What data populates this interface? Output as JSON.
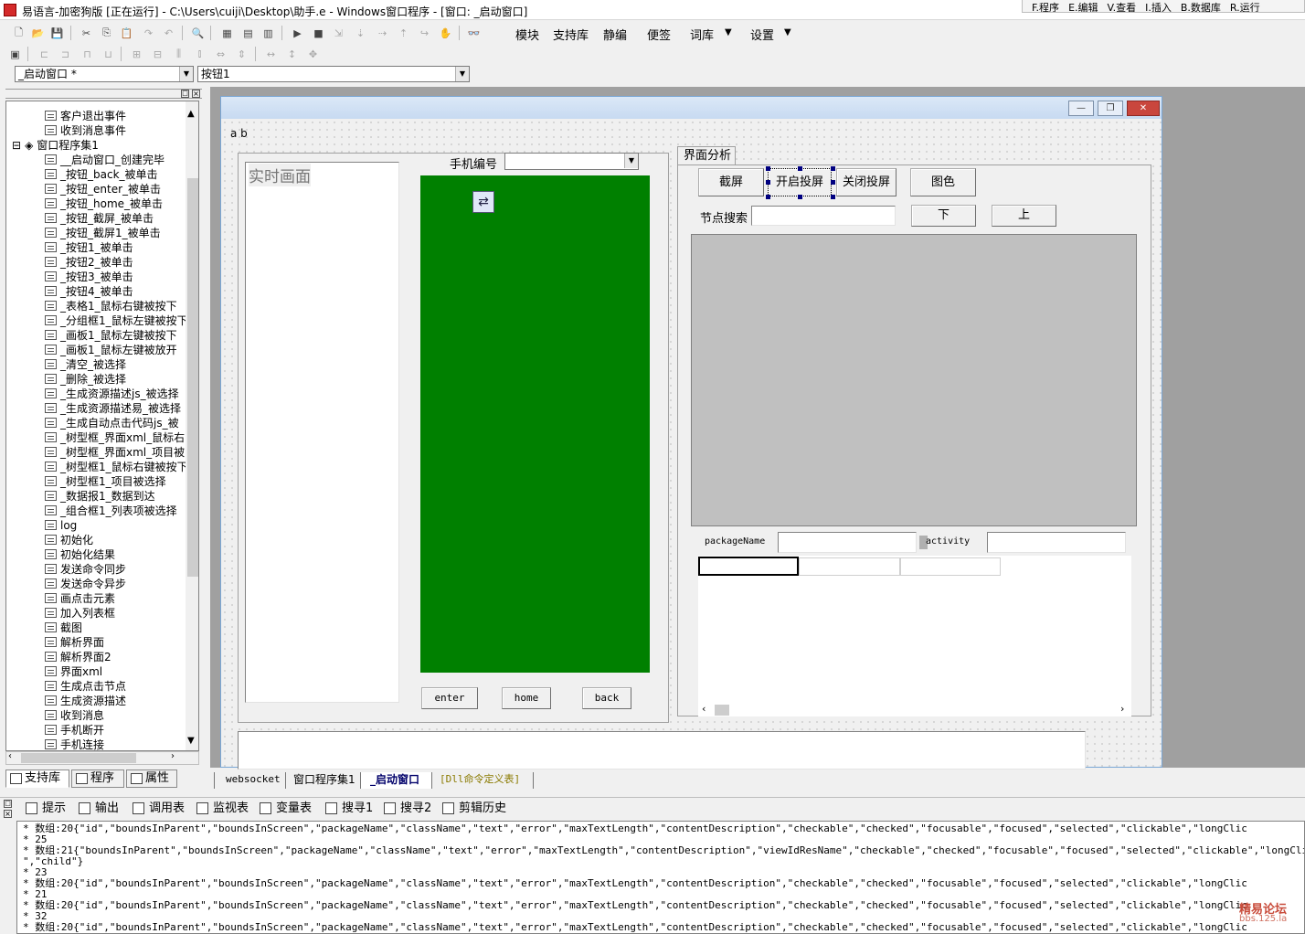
{
  "window": {
    "title": "易语言-加密狗版 [正在运行] - C:\\Users\\cuiji\\Desktop\\助手.e - Windows窗口程序 - [窗口: _启动窗口]"
  },
  "float_menu": [
    "F.程序",
    "E.编辑",
    "V.查看",
    "I.插入",
    "B.数据库",
    "R.运行"
  ],
  "main_menu": [
    "模块",
    "支持库",
    "静编",
    "便签",
    "词库",
    "设置"
  ],
  "combos": {
    "object": "_启动窗口 *",
    "component": "按钮1"
  },
  "tree": [
    "客户退出事件",
    "收到消息事件",
    "窗口程序集1",
    "__启动窗口_创建完毕",
    "_按钮_back_被单击",
    "_按钮_enter_被单击",
    "_按钮_home_被单击",
    "_按钮_截屏_被单击",
    "_按钮_截屏1_被单击",
    "_按钮1_被单击",
    "_按钮2_被单击",
    "_按钮3_被单击",
    "_按钮4_被单击",
    "_表格1_鼠标右键被按下",
    "_分组框1_鼠标左键被按下",
    "_画板1_鼠标左键被按下",
    "_画板1_鼠标左键被放开",
    "_清空_被选择",
    "_删除_被选择",
    "_生成资源描述js_被选择",
    "_生成资源描述易_被选择",
    "_生成自动点击代码js_被",
    "_树型框_界面xml_鼠标右",
    "_树型框_界面xml_项目被",
    "_树型框1_鼠标右键被按下",
    "_树型框1_项目被选择",
    "_数据报1_数据到达",
    "_组合框1_列表项被选择",
    "log",
    "初始化",
    "初始化结果",
    "发送命令同步",
    "发送命令异步",
    "画点击元素",
    "加入列表框",
    "截图",
    "解析界面",
    "解析界面2",
    "界面xml",
    "生成点击节点",
    "生成资源描述",
    "收到消息",
    "手机断开",
    "手机连接"
  ],
  "left_tabs": [
    "支持库",
    "程序",
    "属性"
  ],
  "form": {
    "top_label": "a  b",
    "realtime_label": "实时画面",
    "phone_label": "手机编号",
    "phone_value": "",
    "nav_buttons": [
      "enter",
      "home",
      "back"
    ],
    "panel_tab": "界面分析",
    "buttons": [
      "截屏",
      "开启投屏",
      "关闭投屏",
      "图色"
    ],
    "node_search_label": "节点搜索",
    "node_search_value": "",
    "down_label": "下",
    "up_label": "上",
    "package_label": "packageName",
    "package_value": "",
    "activity_label": "activity",
    "activity_value": ""
  },
  "doc_tabs": [
    "websocket",
    "窗口程序集1",
    "_启动窗口",
    "[Dll命令定义表]"
  ],
  "output_tabs": [
    "提示",
    "输出",
    "调用表",
    "监视表",
    "变量表",
    "搜寻1",
    "搜寻2",
    "剪辑历史"
  ],
  "output_lines": [
    "* 数组:20{\"id\",\"boundsInParent\",\"boundsInScreen\",\"packageName\",\"className\",\"text\",\"error\",\"maxTextLength\",\"contentDescription\",\"checkable\",\"checked\",\"focusable\",\"focused\",\"selected\",\"clickable\",\"longClic",
    "* 25",
    "* 数组:21{\"boundsInParent\",\"boundsInScreen\",\"packageName\",\"className\",\"text\",\"error\",\"maxTextLength\",\"contentDescription\",\"viewIdResName\",\"checkable\",\"checked\",\"focusable\",\"focused\",\"selected\",\"clickable\",\"longClic",
    "\",\"child\"}",
    "* 23",
    "* 数组:20{\"id\",\"boundsInParent\",\"boundsInScreen\",\"packageName\",\"className\",\"text\",\"error\",\"maxTextLength\",\"contentDescription\",\"checkable\",\"checked\",\"focusable\",\"focused\",\"selected\",\"clickable\",\"longClic",
    "* 21",
    "* 数组:20{\"id\",\"boundsInParent\",\"boundsInScreen\",\"packageName\",\"className\",\"text\",\"error\",\"maxTextLength\",\"contentDescription\",\"checkable\",\"checked\",\"focusable\",\"focused\",\"selected\",\"clickable\",\"longClic",
    "* 32",
    "* 数组:20{\"id\",\"boundsInParent\",\"boundsInScreen\",\"packageName\",\"className\",\"text\",\"error\",\"maxTextLength\",\"contentDescription\",\"checkable\",\"checked\",\"focusable\",\"focused\",\"selected\",\"clickable\",\"longClic"
  ],
  "watermark": {
    "main": "精易论坛",
    "sub": "bbs.125.la"
  },
  "colors": {
    "phone_screen": "#008000",
    "canvas": "#c0c0c0",
    "selection_handle": "#000080"
  }
}
